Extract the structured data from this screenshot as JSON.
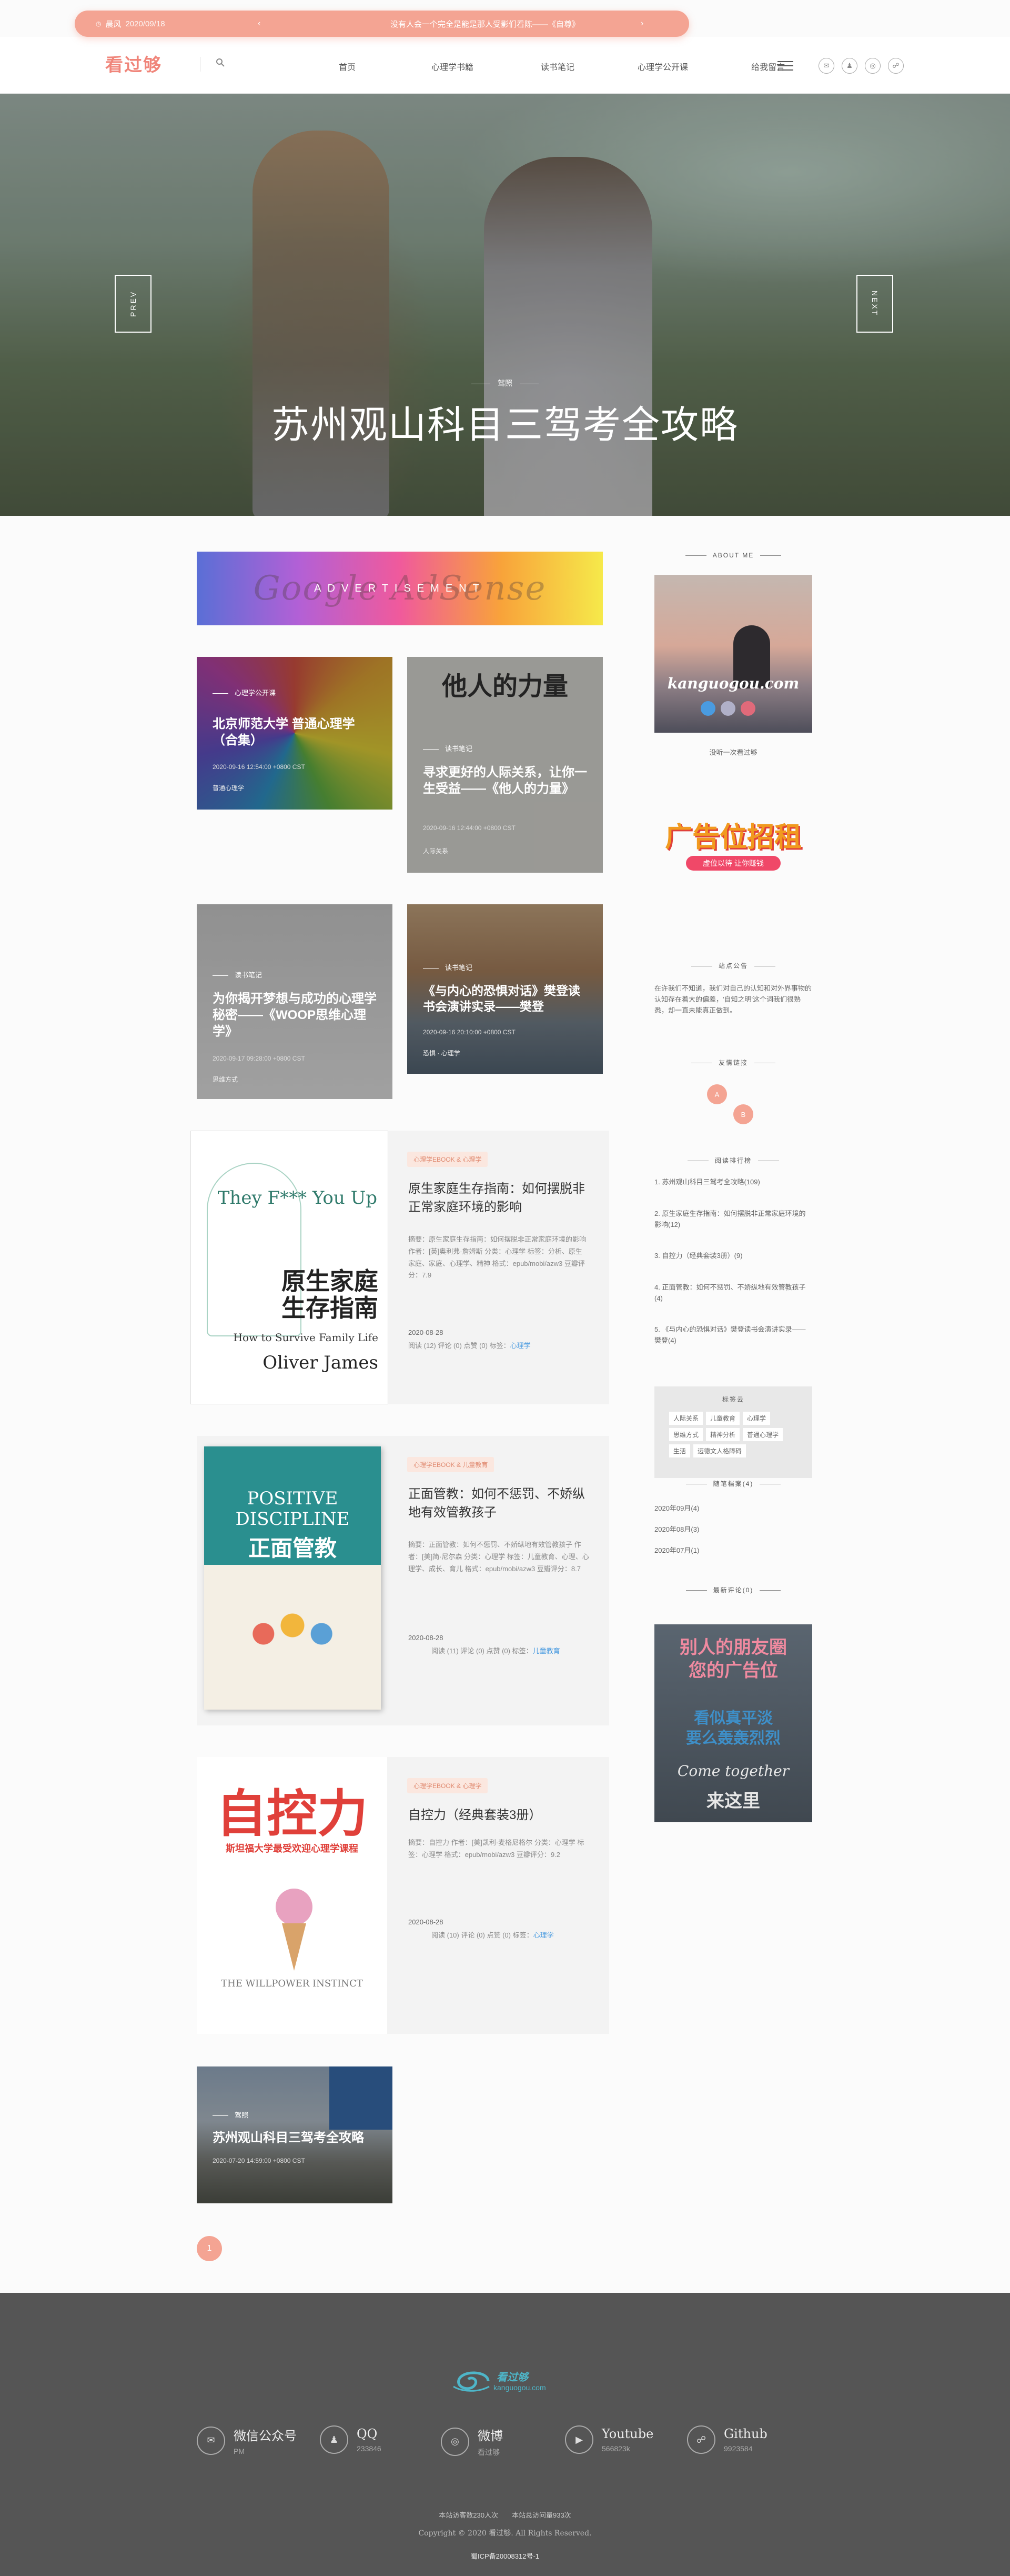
{
  "notice": {
    "tag": "晨风",
    "date": "2020/09/18",
    "message": "没有人会一个完全是能是那人受影们看陈——《自尊》"
  },
  "header": {
    "logo": "看过够",
    "nav": [
      "首页",
      "心理学书籍",
      "读书笔记",
      "心理学公开课",
      "给我留言"
    ],
    "socials": [
      "wechat-icon",
      "qq-icon",
      "weibo-icon",
      "github-icon"
    ]
  },
  "hero": {
    "prev": "PREV",
    "next": "NEXT",
    "category": "驾照",
    "title": "苏州观山科目三驾考全攻略"
  },
  "ad": {
    "label": "ADVERTISEMENT",
    "ghost": "Google AdSense"
  },
  "cards": [
    {
      "category": "心理学公开课",
      "title": "北京师范大学 普通心理学（合集）",
      "meta": "2020-09-16 12:54:00 +0800 CST",
      "tag": "普通心理学"
    },
    {
      "category": "读书笔记",
      "title": "寻求更好的人际关系，让你一生受益——《他人的力量》",
      "meta": "2020-09-16 12:44:00 +0800 CST",
      "tag": "人际关系"
    },
    {
      "category": "读书笔记",
      "title": "为你揭开梦想与成功的心理学秘密——《WOOP思维心理学》",
      "meta": "2020-09-17 09:28:00 +0800 CST",
      "tag": "思维方式"
    },
    {
      "category": "读书笔记",
      "title": "《与内心的恐惧对话》樊登读书会演讲实录——樊登",
      "meta": "2020-09-16 20:10:00 +0800 CST",
      "tag": "恐惧 · 心理学"
    }
  ],
  "books": [
    {
      "tags": "心理学EBOOK & 心理学",
      "title": "原生家庭生存指南：如何摆脱非正常家庭环境的影响",
      "desc": "摘要：原生家庭生存指南：如何摆脱非正常家庭环境的影响 作者：[英]奥利弗·詹姆斯 分类：心理学 标签：分析、原生家庭、家庭、心理学、精神 格式：epub/mobi/azw3 豆瓣评分：7.9",
      "date": "2020-08-28",
      "stats": "阅读 (12) 评论 (0) 点赞 (0) 标签：",
      "label": "心理学",
      "cover": {
        "t1": "原生家庭",
        "t2": "生存指南",
        "sub": "How to Survive Family Life",
        "author": "Oliver James",
        "top": "They F*** You Up"
      }
    },
    {
      "tags": "心理学EBOOK & 儿童教育",
      "title": "正面管教：如何不惩罚、不娇纵地有效管教孩子",
      "desc": "摘要：正面管教：如何不惩罚、不娇纵地有效管教孩子 作者：[美]简·尼尔森 分类：心理学 标签：儿童教育、心理、心理学、成长、育儿 格式：epub/mobi/azw3 豆瓣评分：8.7",
      "date": "2020-08-28",
      "stats": "阅读 (11) 评论 (0) 点赞 (0) 标签：",
      "label": "儿童教育",
      "cover": {
        "t1": "POSITIVE",
        "t2": "DISCIPLINE",
        "t3": "正面管教"
      }
    },
    {
      "tags": "心理学EBOOK & 心理学",
      "title": "自控力（经典套装3册）",
      "desc": "摘要：自控力 作者：[美]凯利·麦格尼格尔 分类：心理学 标签：心理学 格式：epub/mobi/azw3 豆瓣评分：9.2",
      "date": "2020-08-28",
      "stats": "阅读 (10) 评论 (0) 点赞 (0) 标签：",
      "label": "心理学",
      "cover": {
        "t1": "自控力",
        "t2": "斯坦福大学最受欢迎心理学课程",
        "t3": "THE WILLPOWER INSTINCT"
      }
    }
  ],
  "lastCard": {
    "category": "驾照",
    "title": "苏州观山科目三驾考全攻略",
    "meta": "2020-07-20 14:59:00 +0800 CST"
  },
  "pagination": {
    "current": "1"
  },
  "sidebar": {
    "about_head": "ABOUT ME",
    "about_site": "kanguogou.com",
    "about_caption": "没听一次看过够",
    "ad_big": "广告位招租",
    "ad_sub": "虚位以待 让你赚钱",
    "notice_head": "站点公告",
    "notice_text": "在许我们不知道，我们对自己的认知和对外界事物的认知存在着大的偏差，'自知之明'这个词我们很熟悉，却一直未能真正做到。",
    "friends_head": "友情链接",
    "friends": [
      "A",
      "B"
    ],
    "reading_head": "阅读排行榜",
    "reading": [
      "1. 苏州观山科目三驾考全攻略(109)",
      "2. 原生家庭生存指南：如何摆脱非正常家庭环境的影响(12)",
      "3. 自控力（经典套装3册）(9)",
      "4. 正面管教：如何不惩罚、不娇纵地有效管教孩子(4)",
      "5. 《与内心的恐惧对话》樊登读书会演讲实录——樊登(4)"
    ],
    "tags_head": "标签云",
    "tags": [
      "人际关系",
      "儿童教育",
      "心理学",
      "思维方式",
      "精神分析",
      "普通心理学",
      "生活",
      "迈德文人格障碍"
    ],
    "archive_head": "随笔档案(4)",
    "archive": [
      "2020年09月(4)",
      "2020年08月(3)",
      "2020年07月(1)"
    ],
    "comments_head": "最新评论(0)",
    "ad2_t1": "别人的朋友圈",
    "ad2_t2": "您的广告位",
    "ad2_t3": "看似真平淡",
    "ad2_t4": "要么轰轰烈烈",
    "ad2_t5": "Come together",
    "ad2_t6": "来这里"
  },
  "footer": {
    "logo": "看过够",
    "logo_sub": "kanguogou.com",
    "socials": [
      {
        "name": "微信公众号",
        "sub": "PM",
        "icon": "wechat-icon"
      },
      {
        "name": "QQ",
        "sub": "233846",
        "icon": "qq-icon"
      },
      {
        "name": "微博",
        "sub": "看过够",
        "icon": "weibo-icon"
      },
      {
        "name": "Youtube",
        "sub": "566823k",
        "icon": "youtube-icon"
      },
      {
        "name": "Github",
        "sub": "9923584",
        "icon": "github-icon"
      }
    ],
    "stats": "本站访客数230人次　　本站总访问量933次",
    "copyright": "Copyright © 2020 看过够. All Rights Reserved.",
    "icp": "蜀ICP备20008312号-1"
  },
  "colors": {
    "accent": "#f0857a",
    "notice_bg": "#f4a493",
    "link": "#4a9be0",
    "footer_bg": "#555555"
  }
}
